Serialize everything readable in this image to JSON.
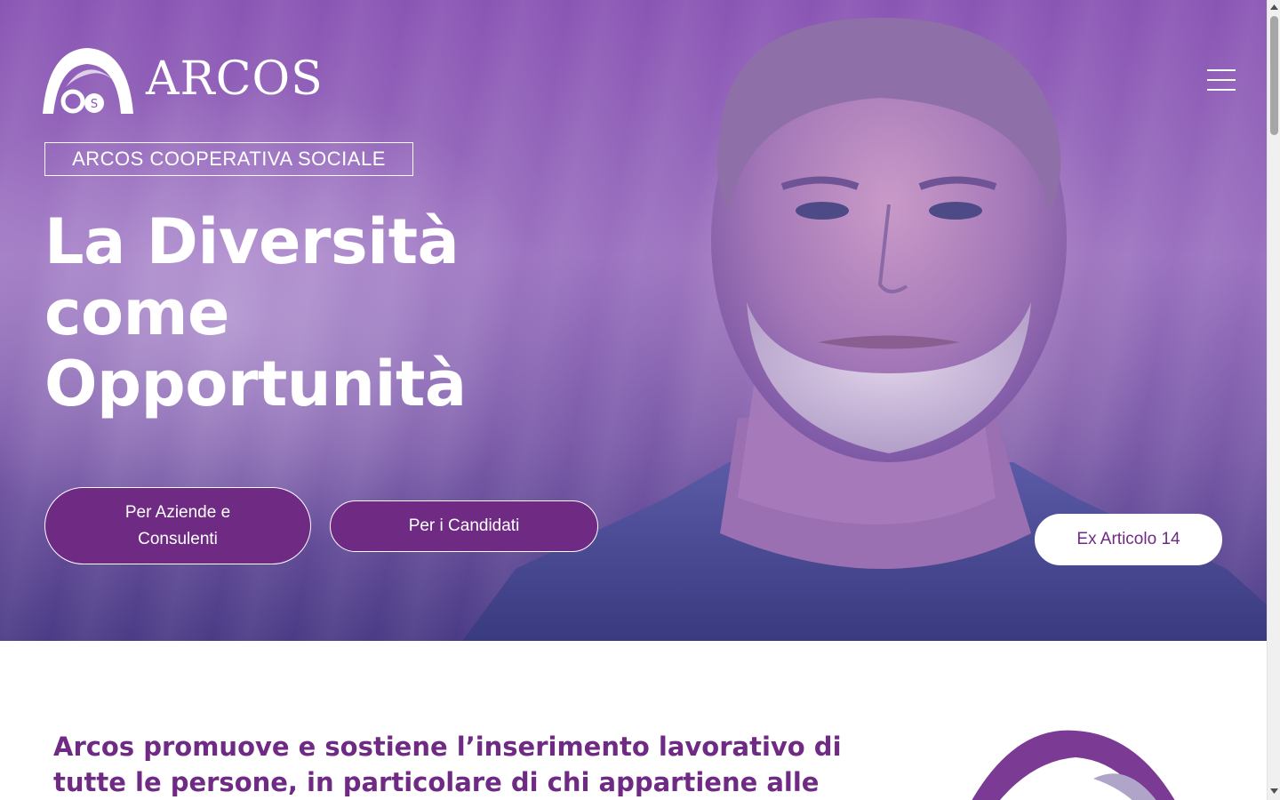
{
  "brand": {
    "logo_text": "ARCOS",
    "tagline": "ARCOS COOPERATIVA SOCIALE"
  },
  "nav": {
    "menu_icon": "hamburger-menu-icon"
  },
  "hero": {
    "headline_lines": [
      "La Diversità",
      "come",
      "Opportunità"
    ],
    "buttons": {
      "aziende": "Per Aziende e Consulenti",
      "candidati": "Per i Candidati",
      "articolo": "Ex Articolo 14"
    }
  },
  "intro": {
    "text": "Arcos promuove e sostiene l’inserimento lavorativo di tutte le persone, in particolare di chi appartiene alle categorie protette,"
  },
  "colors": {
    "brand_purple": "#6f2a84",
    "hero_overlay": "#8a55b4",
    "text_white": "#ffffff"
  }
}
